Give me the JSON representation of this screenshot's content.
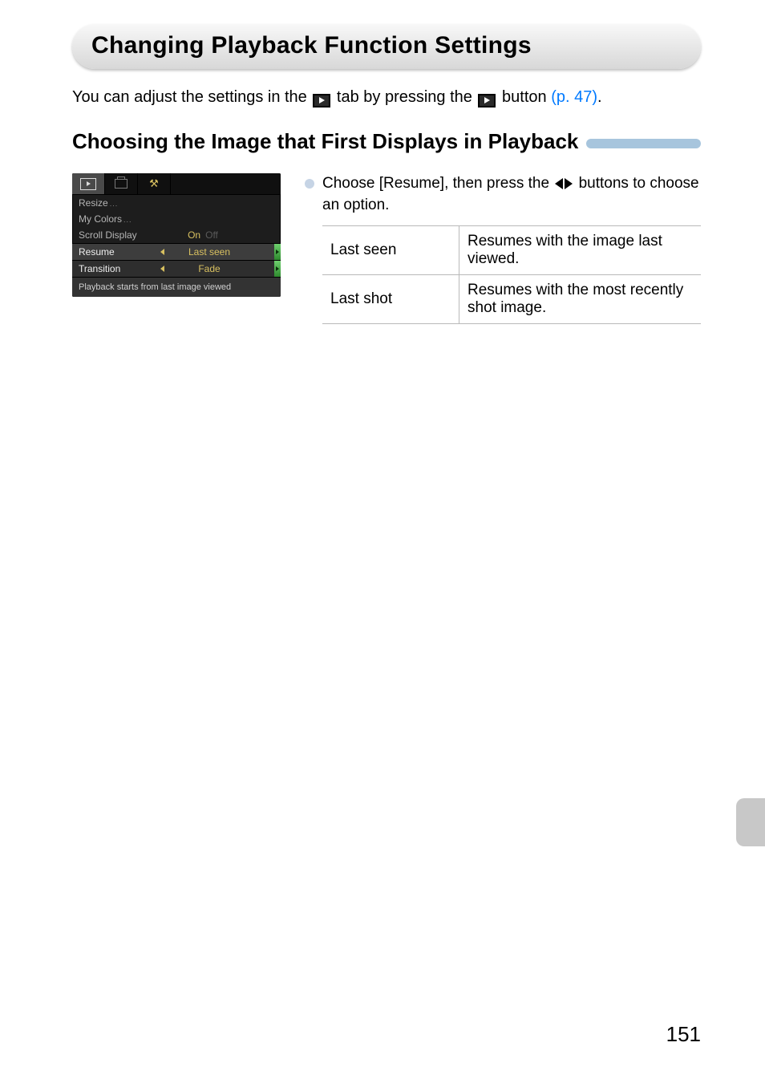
{
  "page_title": "Changing Playback Function Settings",
  "intro": {
    "prefix": "You can adjust the settings in the ",
    "mid": " tab by pressing the ",
    "suffix": " button ",
    "link": "(p. 47)",
    "period": "."
  },
  "subhead": "Choosing the Image that First Displays in Playback",
  "cam_menu": {
    "rows": [
      {
        "label": "Resize",
        "value": ""
      },
      {
        "label": "My Colors",
        "value": ""
      },
      {
        "label": "Scroll Display",
        "on": "On",
        "off": "Off"
      },
      {
        "label": "Resume",
        "value": "Last seen",
        "hl": true
      },
      {
        "label": "Transition",
        "value": "Fade",
        "hl2": true
      }
    ],
    "help": "Playback starts from last image viewed"
  },
  "instruction": {
    "part1": "Choose [Resume], then press the ",
    "part2": " buttons to choose an option."
  },
  "options": [
    {
      "name": "Last seen",
      "desc": "Resumes with the image last viewed."
    },
    {
      "name": "Last shot",
      "desc": "Resumes with the most recently shot image."
    }
  ],
  "page_number": "151"
}
